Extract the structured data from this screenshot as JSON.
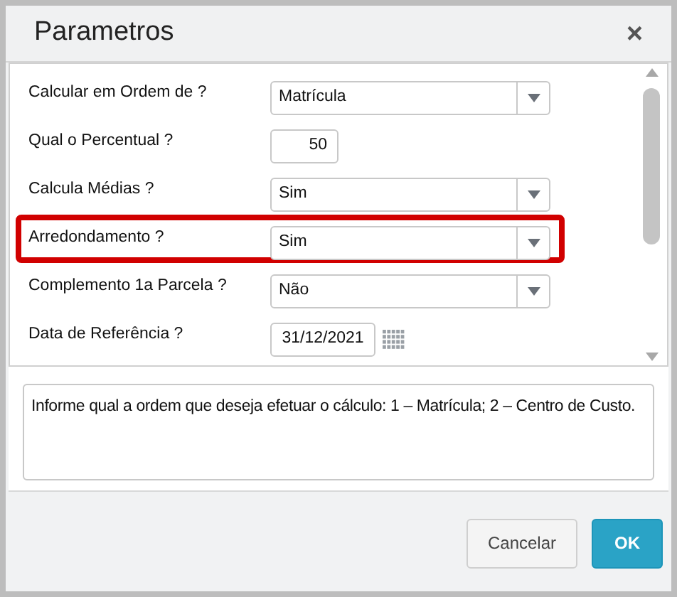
{
  "window": {
    "title": "Parametros",
    "close": "×"
  },
  "fields": [
    {
      "label": "Calcular em Ordem de ?",
      "kind": "select",
      "value": "Matrícula",
      "highlighted": false
    },
    {
      "label": "Qual o Percentual ?",
      "kind": "number",
      "value": "50",
      "highlighted": false
    },
    {
      "label": "Calcula Médias ?",
      "kind": "select",
      "value": "Sim",
      "highlighted": false
    },
    {
      "label": "Arredondamento ?",
      "kind": "select",
      "value": "Sim",
      "highlighted": true
    },
    {
      "label": "Complemento 1a Parcela ?",
      "kind": "select",
      "value": "Não",
      "highlighted": false
    },
    {
      "label": "Data de Referência ?",
      "kind": "date",
      "value": "31/12/2021",
      "highlighted": false
    }
  ],
  "help": "Informe qual a ordem que deseja efetuar o cálculo: 1 – Matrícula; 2 – Centro de Custo.",
  "buttons": [
    {
      "label": "Cancelar",
      "kind": "secondary"
    },
    {
      "label": "OK",
      "kind": "primary"
    }
  ]
}
